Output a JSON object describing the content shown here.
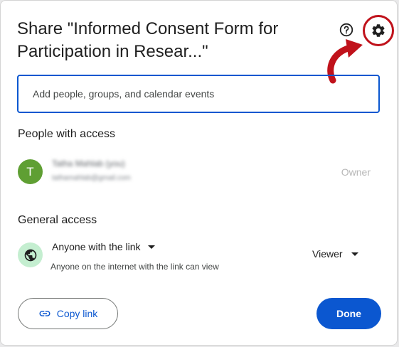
{
  "dialog": {
    "title": "Share \"Informed Consent Form for Participation in Resear...\"",
    "help_icon": "help-circle-icon",
    "settings_icon": "gear-icon",
    "highlight_color": "#c0121b"
  },
  "add_people": {
    "placeholder": "Add people, groups, and calendar events"
  },
  "people_with_access": {
    "heading": "People with access",
    "people": [
      {
        "avatar_initial": "T",
        "avatar_color": "#5f9f33",
        "name": "Tatha Mahlab (you)",
        "email": "tathamahlab@gmail.com",
        "role": "Owner"
      }
    ]
  },
  "general_access": {
    "heading": "General access",
    "icon": "globe-icon",
    "selected_option": "Anyone with the link",
    "description": "Anyone on the internet with the link can view",
    "role": "Viewer"
  },
  "footer": {
    "copy_link_label": "Copy link",
    "copy_link_icon": "link-icon",
    "done_label": "Done",
    "accent_color": "#0b57d0"
  }
}
